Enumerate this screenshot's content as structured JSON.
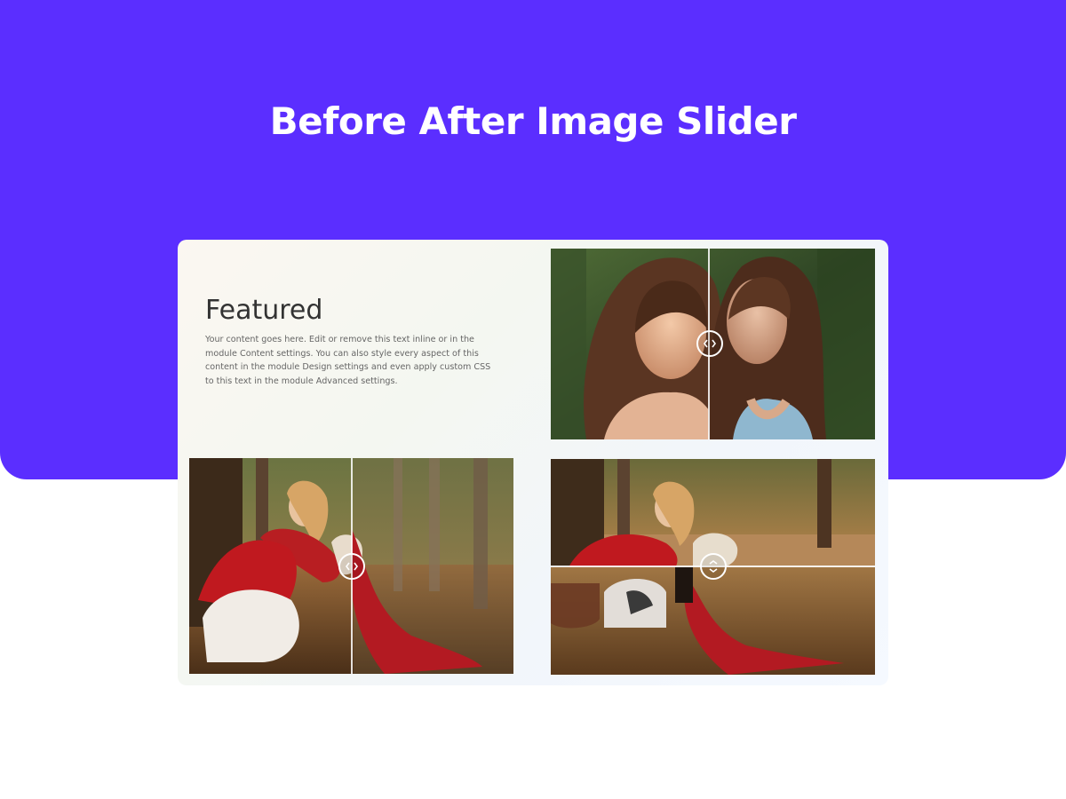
{
  "hero": {
    "title": "Before After Image Slider",
    "background_color": "#5b2eff"
  },
  "featured": {
    "heading": "Featured",
    "body": "Your content goes here. Edit or remove this text inline or in the module Content settings. You can also style every aspect of this content in the module Design settings and even apply custom CSS to this text in the module Advanced settings."
  },
  "sliders": [
    {
      "subject": "two women portrait",
      "orientation": "horizontal",
      "position": 0.49,
      "handle_icon": "chevron-left-right-icon"
    },
    {
      "subject": "woman in red sweater with dog in forest",
      "orientation": "horizontal",
      "position": 0.5,
      "handle_icon": "chevron-left-right-icon"
    },
    {
      "subject": "woman in red sweater with dog in forest",
      "orientation": "vertical",
      "position": 0.56,
      "handle_icon": "chevron-up-down-icon"
    }
  ]
}
